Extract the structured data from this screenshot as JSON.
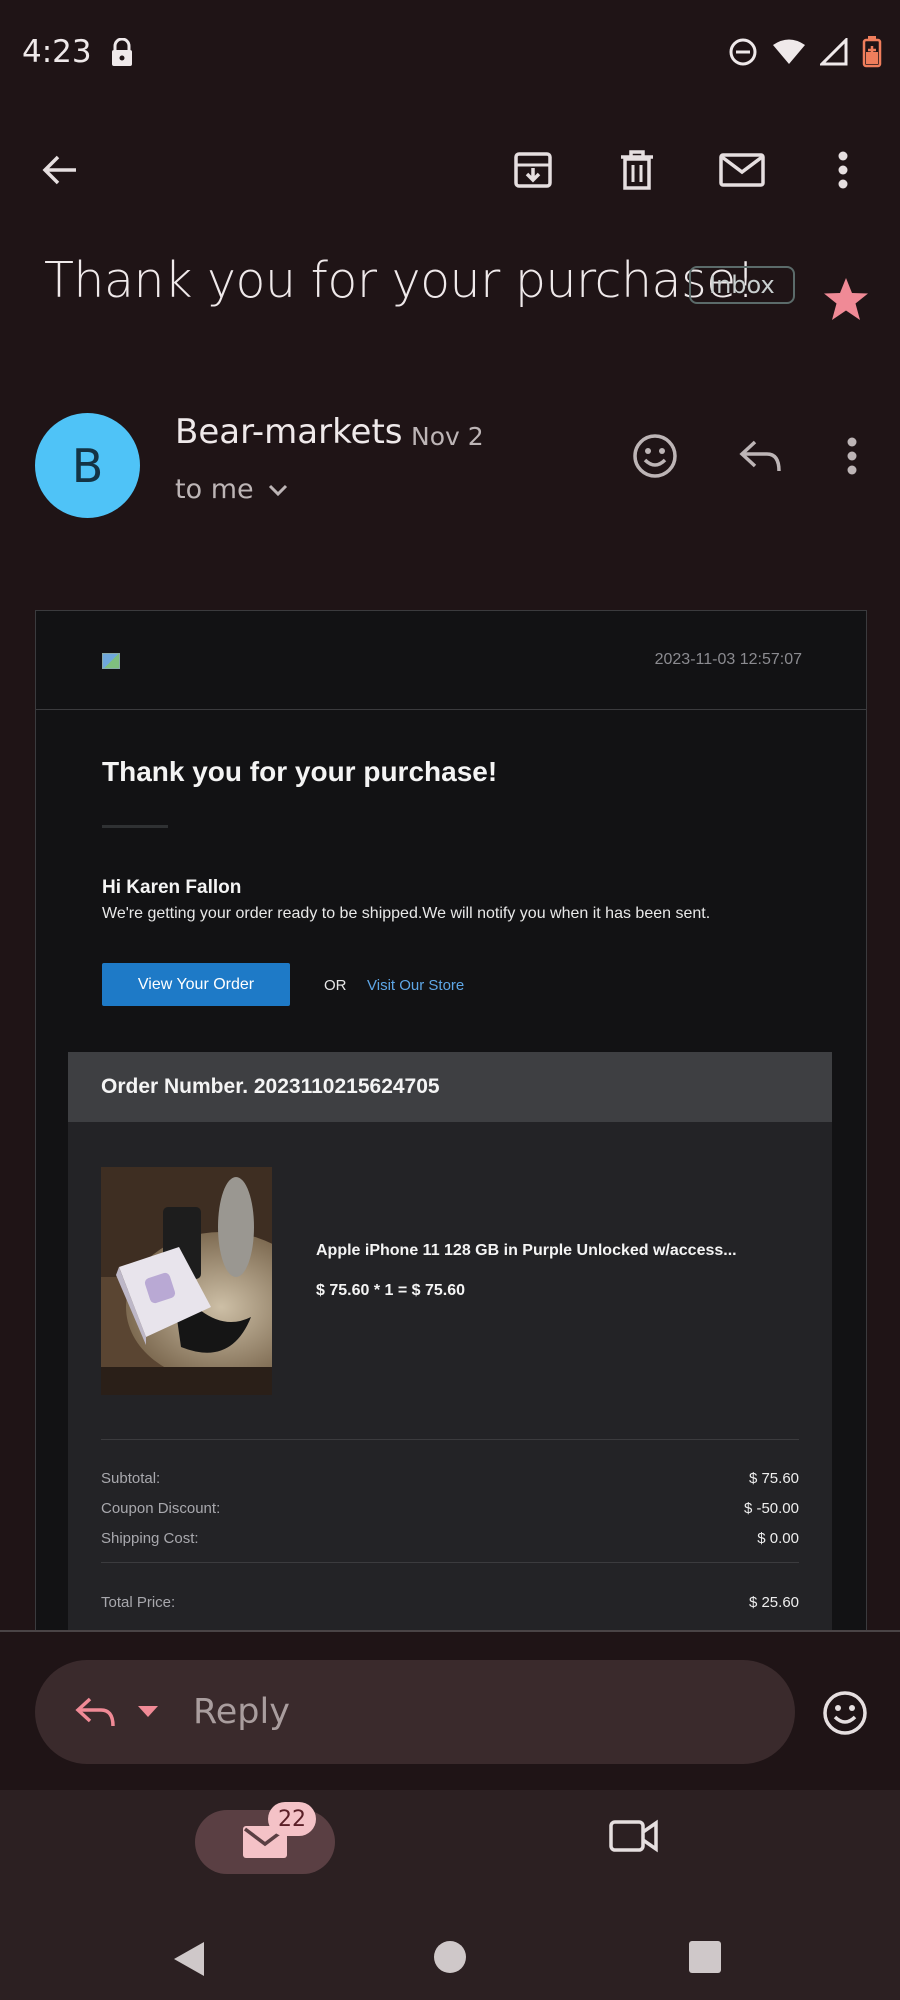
{
  "status_bar": {
    "time": "4:23"
  },
  "email": {
    "subject": "Thank you for your purchase!",
    "label_chip": "Inbox",
    "sender": "Bear-markets",
    "date": "Nov 2",
    "recipient": "to me"
  },
  "body": {
    "timestamp": "2023-11-03 12:57:07",
    "title": "Thank you for your purchase!",
    "greeting": "Hi Karen Fallon",
    "message": "We're getting your order ready to be shipped.We will notify you when it has been sent.",
    "view_order_label": "View Your Order",
    "or_text": "OR",
    "visit_store_label": "Visit Our Store",
    "order_number": "Order Number. 2023110215624705",
    "product": {
      "name": "Apple iPhone 11 128 GB in Purple Unlocked w/access...",
      "price_line": "$ 75.60 * 1 = $ 75.60"
    },
    "summary": [
      {
        "label": "Subtotal:",
        "value": "$ 75.60"
      },
      {
        "label": "Coupon Discount:",
        "value": "$ -50.00"
      },
      {
        "label": "Shipping Cost:",
        "value": "$ 0.00"
      }
    ],
    "total": {
      "label": "Total Price:",
      "value": "$ 25.60"
    }
  },
  "reply": {
    "placeholder": "Reply"
  },
  "bottom_nav": {
    "mail_badge": "22"
  },
  "colors": {
    "background": "#1f1416",
    "accent_star": "#f08a96",
    "avatar": "#4fc3f7",
    "button_blue": "#1e7ac7"
  },
  "icons": [
    "lock-icon",
    "dnd-icon",
    "wifi-icon",
    "signal-icon",
    "battery-icon",
    "back-arrow-icon",
    "archive-icon",
    "trash-icon",
    "mail-icon",
    "more-vert-icon",
    "star-icon",
    "emoji-icon",
    "reply-icon",
    "chevron-down-icon",
    "video-icon"
  ]
}
